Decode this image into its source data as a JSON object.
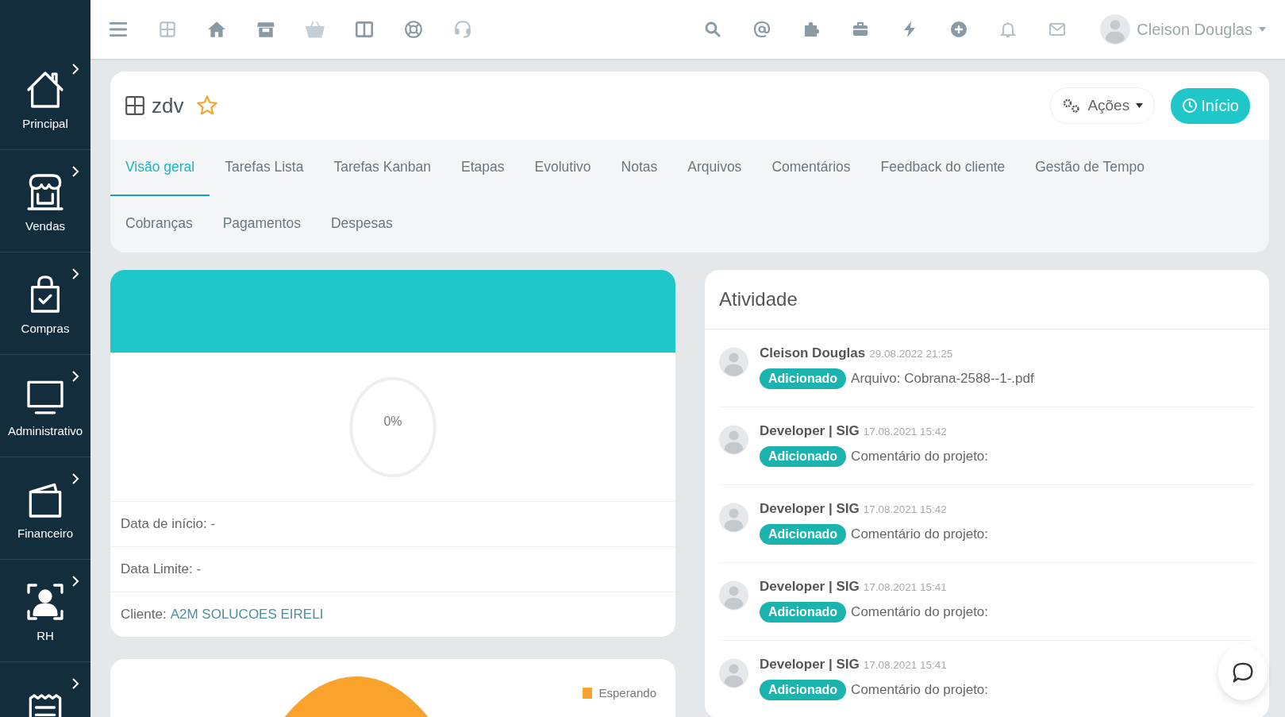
{
  "sidebar": {
    "items": [
      {
        "kind": "home",
        "label": "Principal"
      },
      {
        "kind": "store",
        "label": "Vendas"
      },
      {
        "kind": "bag",
        "label": "Compras"
      },
      {
        "kind": "monitor",
        "label": "Administrativo"
      },
      {
        "kind": "wallet",
        "label": "Financeiro"
      },
      {
        "kind": "person",
        "label": "RH"
      },
      {
        "kind": "receipt"
      }
    ]
  },
  "topbar": {
    "user": "Cleison Douglas"
  },
  "project": {
    "title": "zdv",
    "favorite": true,
    "actions_button": "Ações",
    "start_button": "Início"
  },
  "tabs": [
    {
      "label": "Visão geral",
      "selected": true
    },
    {
      "label": "Tarefas Lista",
      "selected": false
    },
    {
      "label": "Tarefas Kanban",
      "selected": false
    },
    {
      "label": "Etapas",
      "selected": false
    },
    {
      "label": "Evolutivo",
      "selected": false
    },
    {
      "label": "Notas",
      "selected": false
    },
    {
      "label": "Arquivos",
      "selected": false
    },
    {
      "label": "Comentários",
      "selected": false
    },
    {
      "label": "Feedback do cliente",
      "selected": false
    },
    {
      "label": "Gestão de Tempo",
      "selected": false
    },
    {
      "label": "Cobranças",
      "selected": false
    },
    {
      "label": "Pagamentos",
      "selected": false
    },
    {
      "label": "Despesas",
      "selected": false
    }
  ],
  "overview": {
    "progress": {
      "reading": "0%"
    },
    "details": [
      {
        "label": "Data de início: -"
      },
      {
        "label": "Data Limite: -"
      },
      {
        "label": "Cliente:",
        "link": "A2M SOLUCOES EIRELI"
      }
    ],
    "status_chart": {
      "legend": [
        {
          "label": "Esperando",
          "color": "#f9a32d"
        }
      ]
    }
  },
  "activity": {
    "title": "Atividade",
    "items": [
      {
        "author": "Cleison Douglas",
        "time": "29.08.2022 21:25",
        "badge": "Adicionado",
        "text": "Arquivo: Cobrana-2588--1-.pdf"
      },
      {
        "author": "Developer | SIG",
        "time": "17.08.2021 15:42",
        "badge": "Adicionado",
        "text": "Comentário do projeto:"
      },
      {
        "author": "Developer | SIG",
        "time": "17.08.2021 15:42",
        "badge": "Adicionado",
        "text": "Comentário do projeto:"
      },
      {
        "author": "Developer | SIG",
        "time": "17.08.2021 15:41",
        "badge": "Adicionado",
        "text": "Comentário do projeto:"
      },
      {
        "author": "Developer | SIG",
        "time": "17.08.2021 15:41",
        "badge": "Adicionado",
        "text": "Comentário do projeto:"
      }
    ]
  }
}
